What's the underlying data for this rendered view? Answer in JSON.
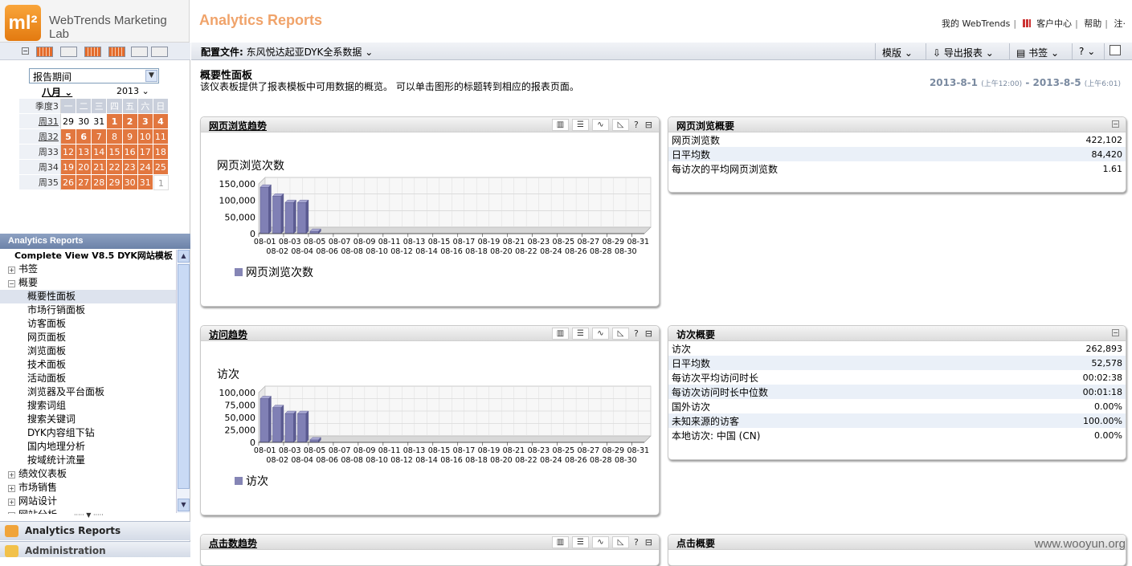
{
  "app": {
    "logo_mark": "ml²",
    "logo_text": "WebTrends Marketing Lab",
    "title": "Analytics Reports"
  },
  "top_links": [
    "我的 WebTrends",
    "客户中心",
    "帮助",
    "注·"
  ],
  "toolbar": {
    "profile_label": "配置文件:",
    "profile_value": "东风悦达起亚DYK全系数据",
    "template": "模版",
    "export": "导出报表",
    "bookmark": "书签",
    "help": "?"
  },
  "calendar": {
    "period_select": "报告期间",
    "month": "八月",
    "year": "2013",
    "header": [
      "季度3",
      "一",
      "二",
      "三",
      "四",
      "五",
      "六",
      "日"
    ],
    "weeks": [
      {
        "label": "周31",
        "days": [
          "29",
          "30",
          "31",
          "1",
          "2",
          "3",
          "4"
        ]
      },
      {
        "label": "周32",
        "days": [
          "5",
          "6",
          "7",
          "8",
          "9",
          "10",
          "11"
        ]
      },
      {
        "label": "周33",
        "days": [
          "12",
          "13",
          "14",
          "15",
          "16",
          "17",
          "18"
        ]
      },
      {
        "label": "周34",
        "days": [
          "19",
          "20",
          "21",
          "22",
          "23",
          "24",
          "25"
        ]
      },
      {
        "label": "周35",
        "days": [
          "26",
          "27",
          "28",
          "29",
          "30",
          "31",
          "1"
        ]
      }
    ]
  },
  "nav": {
    "header": "Analytics Reports",
    "items": [
      {
        "label": "Complete View V8.5 DYK网站模板",
        "type": "root"
      },
      {
        "label": "书签",
        "type": "plus"
      },
      {
        "label": "概要",
        "type": "minus"
      },
      {
        "label": "概要性面板",
        "type": "child",
        "selected": true
      },
      {
        "label": "市场行销面板",
        "type": "child"
      },
      {
        "label": "访客面板",
        "type": "child"
      },
      {
        "label": "网页面板",
        "type": "child"
      },
      {
        "label": "浏览面板",
        "type": "child"
      },
      {
        "label": "技术面板",
        "type": "child"
      },
      {
        "label": "活动面板",
        "type": "child"
      },
      {
        "label": "浏览器及平台面板",
        "type": "child"
      },
      {
        "label": "搜索词组",
        "type": "child"
      },
      {
        "label": "搜索关键词",
        "type": "child"
      },
      {
        "label": "DYK内容组下钻",
        "type": "child"
      },
      {
        "label": "国内地理分析",
        "type": "child"
      },
      {
        "label": "按域统计流量",
        "type": "child"
      },
      {
        "label": "绩效仪表板",
        "type": "plus"
      },
      {
        "label": "市场销售",
        "type": "plus"
      },
      {
        "label": "网站设计",
        "type": "plus"
      },
      {
        "label": "网站分析",
        "type": "plus"
      }
    ],
    "bottom_reports": "Analytics Reports",
    "bottom_admin": "Administration"
  },
  "main": {
    "title": "概要性面板",
    "description": "该仪表板提供了报表模板中可用数据的概览。 可以单击图形的标题转到相应的报表页面。",
    "date_start": "2013-8-1",
    "date_start_time": "(上午12:00)",
    "date_sep": "-",
    "date_end": "2013-8-5",
    "date_end_time": "(上午6:01)"
  },
  "panels": {
    "pageviews_trend": {
      "title": "网页浏览趋势",
      "chart_title": "网页浏览次数",
      "legend": "网页浏览次数"
    },
    "pageviews_summary": {
      "title": "网页浏览概要",
      "rows": [
        {
          "label": "网页浏览数",
          "value": "422,102"
        },
        {
          "label": "日平均数",
          "value": "84,420"
        },
        {
          "label": "每访次的平均网页浏览数",
          "value": "1.61"
        }
      ]
    },
    "visits_trend": {
      "title": "访问趋势",
      "chart_title": "访次",
      "legend": "访次"
    },
    "visits_summary": {
      "title": "访次概要",
      "rows": [
        {
          "label": "访次",
          "value": "262,893"
        },
        {
          "label": "日平均数",
          "value": "52,578"
        },
        {
          "label": "每访次平均访问时长",
          "value": "00:02:38"
        },
        {
          "label": "每访次访问时长中位数",
          "value": "00:01:18"
        },
        {
          "label": "国外访次",
          "value": "0.00%"
        },
        {
          "label": "未知来源的访客",
          "value": "100.00%"
        },
        {
          "label": "本地访次: 中国 (CN)",
          "value": "0.00%"
        }
      ]
    },
    "clicks_trend": {
      "title": "点击数趋势"
    },
    "clicks_summary": {
      "title": "点击概要"
    }
  },
  "chart_data": [
    {
      "type": "bar",
      "title": "网页浏览次数",
      "series": [
        {
          "name": "网页浏览次数",
          "values": [
            140000,
            113000,
            94000,
            94000,
            7000,
            0,
            0,
            0,
            0,
            0,
            0,
            0,
            0,
            0,
            0,
            0,
            0,
            0,
            0,
            0,
            0,
            0,
            0,
            0,
            0,
            0,
            0,
            0,
            0,
            0,
            0
          ]
        }
      ],
      "categories": [
        "08-01",
        "08-02",
        "08-03",
        "08-04",
        "08-05",
        "08-06",
        "08-07",
        "08-08",
        "08-09",
        "08-10",
        "08-11",
        "08-12",
        "08-13",
        "08-14",
        "08-15",
        "08-16",
        "08-17",
        "08-18",
        "08-19",
        "08-20",
        "08-21",
        "08-22",
        "08-23",
        "08-24",
        "08-25",
        "08-26",
        "08-27",
        "08-28",
        "08-29",
        "08-30",
        "08-31"
      ],
      "yticks": [
        "0",
        "50,000",
        "100,000",
        "150,000"
      ],
      "ylim": [
        0,
        150000
      ]
    },
    {
      "type": "bar",
      "title": "访次",
      "series": [
        {
          "name": "访次",
          "values": [
            88000,
            70000,
            58000,
            58000,
            5000,
            0,
            0,
            0,
            0,
            0,
            0,
            0,
            0,
            0,
            0,
            0,
            0,
            0,
            0,
            0,
            0,
            0,
            0,
            0,
            0,
            0,
            0,
            0,
            0,
            0,
            0
          ]
        }
      ],
      "categories": [
        "08-01",
        "08-02",
        "08-03",
        "08-04",
        "08-05",
        "08-06",
        "08-07",
        "08-08",
        "08-09",
        "08-10",
        "08-11",
        "08-12",
        "08-13",
        "08-14",
        "08-15",
        "08-16",
        "08-17",
        "08-18",
        "08-19",
        "08-20",
        "08-21",
        "08-22",
        "08-23",
        "08-24",
        "08-25",
        "08-26",
        "08-27",
        "08-28",
        "08-29",
        "08-30",
        "08-31"
      ],
      "yticks": [
        "0",
        "25,000",
        "50,000",
        "75,000",
        "100,000"
      ],
      "ylim": [
        0,
        100000
      ]
    }
  ],
  "watermark": "www.wooyun.org"
}
